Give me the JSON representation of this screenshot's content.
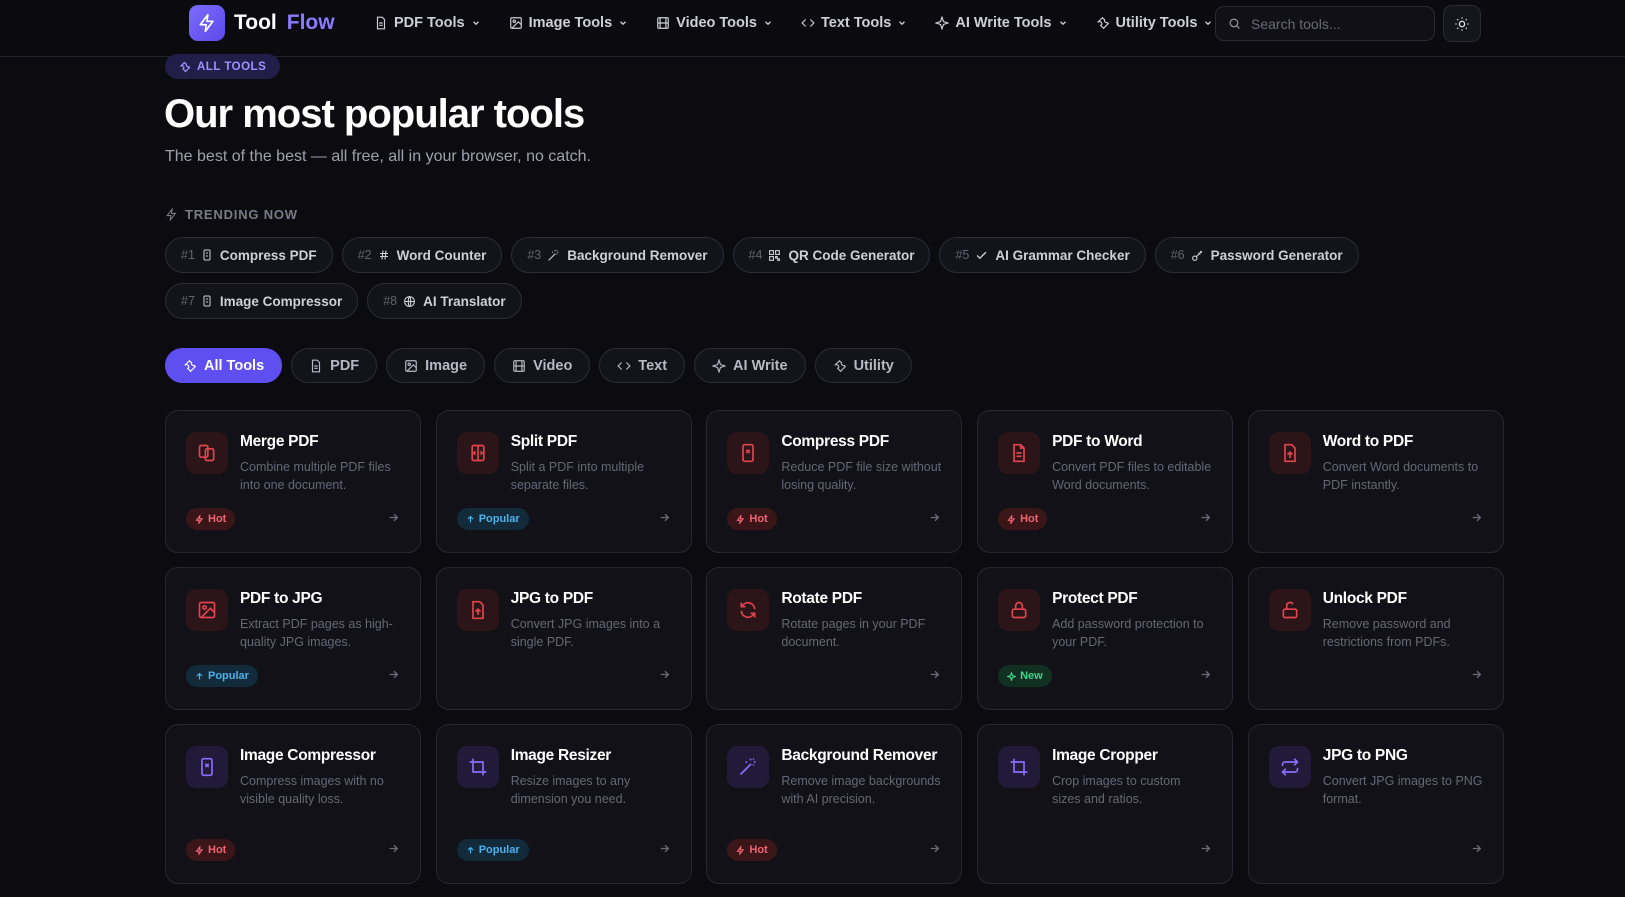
{
  "brand": {
    "name_part1": "Tool",
    "name_part2": "Flow"
  },
  "nav": {
    "items": [
      {
        "label": "PDF Tools",
        "icon": "file-icon"
      },
      {
        "label": "Image Tools",
        "icon": "image-icon"
      },
      {
        "label": "Video Tools",
        "icon": "film-icon"
      },
      {
        "label": "Text Tools",
        "icon": "code-icon"
      },
      {
        "label": "AI Write Tools",
        "icon": "sparkle-icon"
      },
      {
        "label": "Utility Tools",
        "icon": "wrench-icon"
      }
    ],
    "search_placeholder": "Search tools..."
  },
  "hero": {
    "badge": "ALL TOOLS",
    "title": "Our most popular tools",
    "subtitle": "The best of the best — all free, all in your browser, no catch."
  },
  "trending": {
    "label": "TRENDING NOW",
    "items": [
      {
        "rank": "#1",
        "label": "Compress PDF",
        "icon": "compress-icon"
      },
      {
        "rank": "#2",
        "label": "Word Counter",
        "icon": "hash-icon"
      },
      {
        "rank": "#3",
        "label": "Background Remover",
        "icon": "wand-icon"
      },
      {
        "rank": "#4",
        "label": "QR Code Generator",
        "icon": "qr-icon"
      },
      {
        "rank": "#5",
        "label": "AI Grammar Checker",
        "icon": "check-icon"
      },
      {
        "rank": "#6",
        "label": "Password Generator",
        "icon": "key-icon"
      },
      {
        "rank": "#7",
        "label": "Image Compressor",
        "icon": "compress-icon"
      },
      {
        "rank": "#8",
        "label": "AI Translator",
        "icon": "globe-icon"
      }
    ]
  },
  "filters": [
    {
      "label": "All Tools",
      "active": true
    },
    {
      "label": "PDF"
    },
    {
      "label": "Image"
    },
    {
      "label": "Video"
    },
    {
      "label": "Text"
    },
    {
      "label": "AI Write"
    },
    {
      "label": "Utility"
    }
  ],
  "colors": {
    "accent": "#5f4ff0",
    "hot": "#f06470",
    "popular": "#4cb2ec",
    "new": "#3fd38c",
    "pdf_icon": "#e0444e",
    "image_icon": "#8b6cff"
  },
  "tools": [
    {
      "title": "Merge PDF",
      "desc": "Combine multiple PDF files into one document.",
      "tag": "Hot",
      "icon": "merge-icon"
    },
    {
      "title": "Split PDF",
      "desc": "Split a PDF into multiple separate files.",
      "tag": "Popular",
      "icon": "split-icon"
    },
    {
      "title": "Compress PDF",
      "desc": "Reduce PDF file size without losing quality.",
      "tag": "Hot",
      "icon": "compress-icon"
    },
    {
      "title": "PDF to Word",
      "desc": "Convert PDF files to editable Word documents.",
      "tag": "Hot",
      "icon": "document-icon"
    },
    {
      "title": "Word to PDF",
      "desc": "Convert Word documents to PDF instantly.",
      "tag": "",
      "icon": "file-up-icon"
    },
    {
      "title": "PDF to JPG",
      "desc": "Extract PDF pages as high-quality JPG images.",
      "tag": "Popular",
      "icon": "image-icon"
    },
    {
      "title": "JPG to PDF",
      "desc": "Convert JPG images into a single PDF.",
      "tag": "",
      "icon": "file-up-icon"
    },
    {
      "title": "Rotate PDF",
      "desc": "Rotate pages in your PDF document.",
      "tag": "",
      "icon": "rotate-icon"
    },
    {
      "title": "Protect PDF",
      "desc": "Add password protection to your PDF.",
      "tag": "New",
      "icon": "lock-icon"
    },
    {
      "title": "Unlock PDF",
      "desc": "Remove password and restrictions from PDFs.",
      "tag": "",
      "icon": "unlock-icon"
    },
    {
      "title": "Image Compressor",
      "desc": "Compress images with no visible quality loss.",
      "tag": "Hot",
      "icon": "compress-icon"
    },
    {
      "title": "Image Resizer",
      "desc": "Resize images to any dimension you need.",
      "tag": "Popular",
      "icon": "crop-icon"
    },
    {
      "title": "Background Remover",
      "desc": "Remove image backgrounds with AI precision.",
      "tag": "Hot",
      "icon": "wand-icon"
    },
    {
      "title": "Image Cropper",
      "desc": "Crop images to custom sizes and ratios.",
      "tag": "",
      "icon": "crop-icon"
    },
    {
      "title": "JPG to PNG",
      "desc": "Convert JPG images to PNG format.",
      "tag": "",
      "icon": "swap-icon"
    }
  ]
}
